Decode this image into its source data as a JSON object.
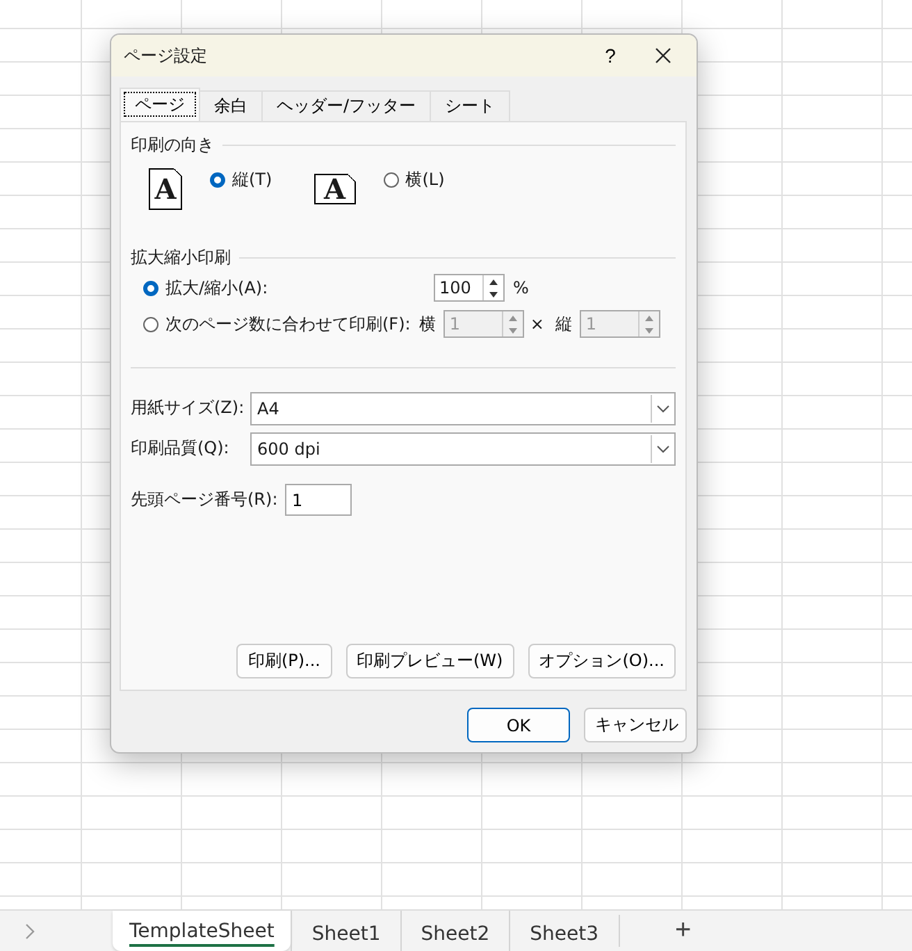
{
  "dialog": {
    "title": "ページ設定",
    "help": "?",
    "tabs": [
      {
        "label": "ページ",
        "selected": true
      },
      {
        "label": "余白",
        "selected": false
      },
      {
        "label": "ヘッダー/フッター",
        "selected": false
      },
      {
        "label": "シート",
        "selected": false
      }
    ],
    "orientation": {
      "heading": "印刷の向き",
      "options": [
        {
          "glyph": "A",
          "kind": "portrait",
          "label": "縦(T)",
          "selected": true
        },
        {
          "glyph": "A",
          "kind": "landscape",
          "label": "横(L)",
          "selected": false
        }
      ]
    },
    "scaling": {
      "heading": "拡大縮小印刷",
      "options": [
        {
          "kind": "percent",
          "label": "拡大/縮小(A):",
          "selected": true,
          "value": "100",
          "unit": "%"
        },
        {
          "kind": "fit",
          "label": "次のページ数に合わせて印刷(F):",
          "selected": false,
          "wide_label": "横",
          "wide_value": "1",
          "times": "×",
          "tall_label": "縦",
          "tall_value": "1"
        }
      ]
    },
    "paper_size": {
      "label": "用紙サイズ(Z):",
      "value": "A4"
    },
    "print_quality": {
      "label": "印刷品質(Q):",
      "value": "600 dpi"
    },
    "first_page_number": {
      "label": "先頭ページ番号(R):",
      "value": "1"
    },
    "actions": [
      "印刷(P)...",
      "印刷プレビュー(W)",
      "オプション(O)..."
    ],
    "buttons": [
      {
        "label": "OK",
        "default": true
      },
      {
        "label": "キャンセル",
        "default": false
      }
    ]
  },
  "sheet_tabs": [
    {
      "label": "TemplateSheet",
      "selected": true
    },
    {
      "label": "Sheet1",
      "selected": false
    },
    {
      "label": "Sheet2",
      "selected": false
    },
    {
      "label": "Sheet3",
      "selected": false
    }
  ],
  "add_sheet": "+"
}
